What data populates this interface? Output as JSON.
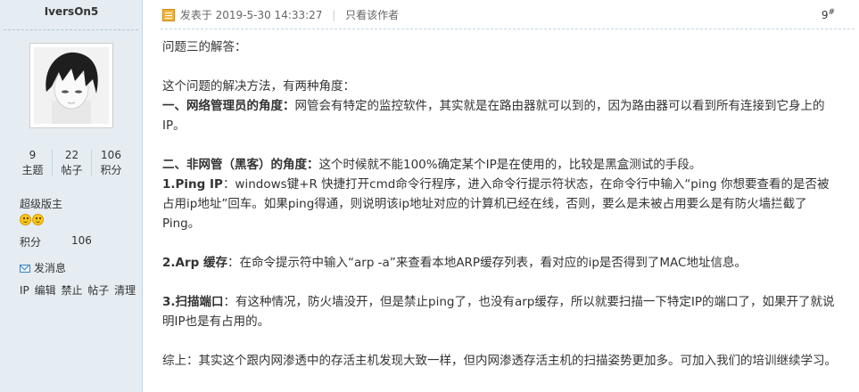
{
  "sidebar": {
    "username": "IversOn5",
    "stats": [
      {
        "value": "9",
        "label": "主题"
      },
      {
        "value": "22",
        "label": "帖子"
      },
      {
        "value": "106",
        "label": "积分"
      }
    ],
    "rank": "超级版主",
    "rank_icons": [
      "smiley-icon",
      "smiley-icon"
    ],
    "points_label": "积分",
    "points_value": "106",
    "send_message": "发消息",
    "admin_links": [
      "IP",
      "编辑",
      "禁止",
      "帖子",
      "清理"
    ]
  },
  "post": {
    "posted_at": "发表于 2019-5-30 14:33:27",
    "author_only": "只看该作者",
    "floor": "9",
    "floor_mark": "#",
    "paragraphs": [
      {
        "text": "问题三的解答："
      },
      {
        "text": "这个问题的解决方法，有两种角度："
      },
      {
        "bold": "一、网络管理员的角度：",
        "text": "网管会有特定的监控软件，其实就是在路由器就可以到的，因为路由器可以看到所有连接到它身上的IP。"
      },
      {
        "bold": "二、非网管（黑客）的角度：",
        "text": "这个时候就不能100%确定某个IP是在使用的，比较是黑盒测试的手段。"
      },
      {
        "bold": "1.Ping IP",
        "text": "：windows键+R 快捷打开cmd命令行程序，进入命令行提示符状态，在命令行中输入“ping 你想要查看的是否被占用ip地址”回车。如果ping得通，则说明该ip地址对应的计算机已经在线，否则，要么是未被占用要么是有防火墙拦截了Ping。"
      },
      {
        "bold": "2.Arp 缓存",
        "text": "：在命令提示符中输入“arp -a”来查看本地ARP缓存列表，看对应的ip是否得到了MAC地址信息。"
      },
      {
        "bold": "3.扫描端口",
        "text": "：有这种情况，防火墙没开，但是禁止ping了，也没有arp缓存，所以就要扫描一下特定IP的端口了，如果开了就说明IP也是有占用的。"
      },
      {
        "text": "综上：其实这个跟内网渗透中的存活主机发现大致一样，但内网渗透存活主机的扫描姿势更加多。可加入我们的培训继续学习。"
      }
    ]
  }
}
